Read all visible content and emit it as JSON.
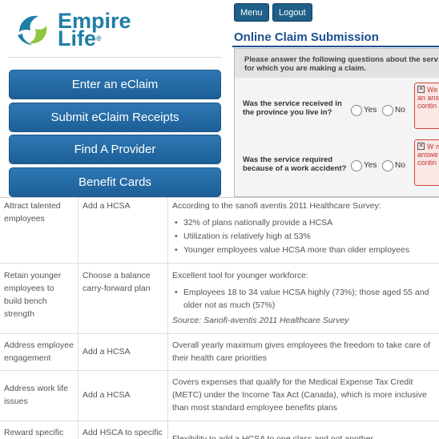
{
  "logo": {
    "line1": "Empire",
    "line2": "Life",
    "mark": "®"
  },
  "menu_buttons": [
    "Enter an eClaim",
    "Submit eClaim Receipts",
    "Find A Provider",
    "Benefit Cards"
  ],
  "topbar": {
    "menu": "Menu",
    "logout": "Logout"
  },
  "claim": {
    "title": "Online Claim Submission",
    "instructions": "Please answer the following questions about the serv for which you are making a claim.",
    "questions": [
      {
        "text": "Was the service received in the province you live in?",
        "yes": "Yes",
        "no": "No",
        "error": "We nee an answ to contin"
      },
      {
        "text": "Was the service required because of a work accident?",
        "yes": "Yes",
        "no": "No",
        "error": "W nee an answe contin"
      }
    ]
  },
  "table_rows": [
    {
      "goal": "Attract talented employees",
      "action": "Add a HCSA",
      "detail": "According to the sanofi aventis 2011 Healthcare Survey:",
      "bullets": [
        "32% of plans nationally provide a HCSA",
        "Utilization is relatively high at 53%",
        "Younger employees value HCSA more than older employees"
      ]
    },
    {
      "goal": "Retain younger employees to build bench strength",
      "action": "Choose a balance carry-forward plan",
      "detail": "Excellent tool for younger workforce:",
      "bullets": [
        "Employees 18 to 34 value HCSA highly (73%); those aged 55 and older not as much (57%)"
      ],
      "source": "Source:  Sanofi-aventis 2011 Healthcare Survey"
    },
    {
      "goal": "Address employee engagement",
      "action": "Add a HCSA",
      "detail": "Overall yearly maximum gives employees the freedom to take care of their health care priorities"
    },
    {
      "goal": "Address work life issues",
      "action": "Add a HCSA",
      "detail": "Covers expenses that qualify for the Medical Expense Tax Credit (METC) under the Income Tax Act (Canada), which is more inclusive than most standard employee benefits plans"
    },
    {
      "goal": "Reward specific",
      "action": "Add HSCA to specific",
      "detail": "Flexibility to add a HCSA to one class and not another"
    }
  ],
  "colors": {
    "brand_blue": "#1e7fa6",
    "button_blue": "#2a72ad",
    "claim_blue": "#1b4f8f",
    "error_red": "#c0392b"
  }
}
